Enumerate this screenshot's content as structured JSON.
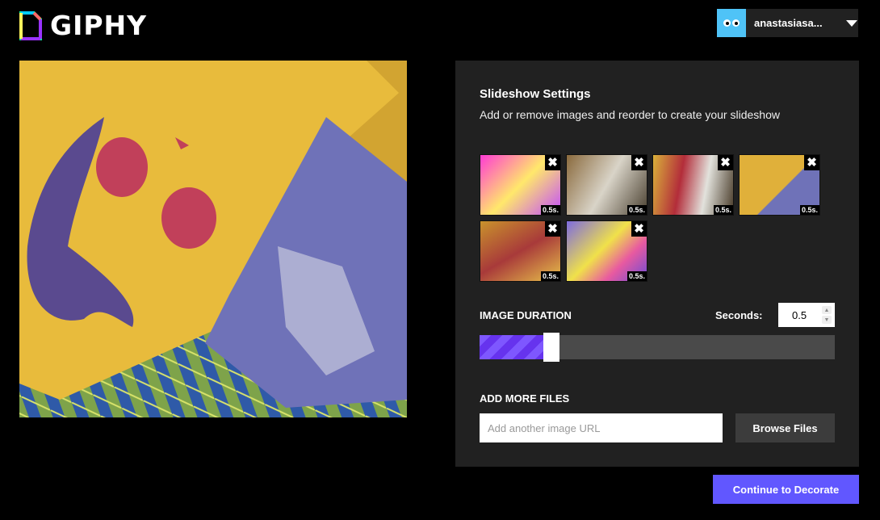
{
  "header": {
    "brand": "GIPHY",
    "username": "anastasiasa..."
  },
  "panel": {
    "title": "Slideshow Settings",
    "subtitle": "Add or remove images and reorder to create your slideshow",
    "thumbnails": [
      {
        "remove_label": "✖",
        "duration": "0.5s."
      },
      {
        "remove_label": "✖",
        "duration": "0.5s."
      },
      {
        "remove_label": "✖",
        "duration": "0.5s."
      },
      {
        "remove_label": "✖",
        "duration": "0.5s."
      },
      {
        "remove_label": "✖",
        "duration": "0.5s."
      },
      {
        "remove_label": "✖",
        "duration": "0.5s."
      }
    ],
    "duration_label": "IMAGE DURATION",
    "seconds_label": "Seconds:",
    "seconds_value": "0.5",
    "slider_fraction": 0.18,
    "add_files_label": "ADD MORE FILES",
    "url_placeholder": "Add another image URL",
    "browse_label": "Browse Files"
  },
  "footer": {
    "continue_label": "Continue to Decorate"
  }
}
